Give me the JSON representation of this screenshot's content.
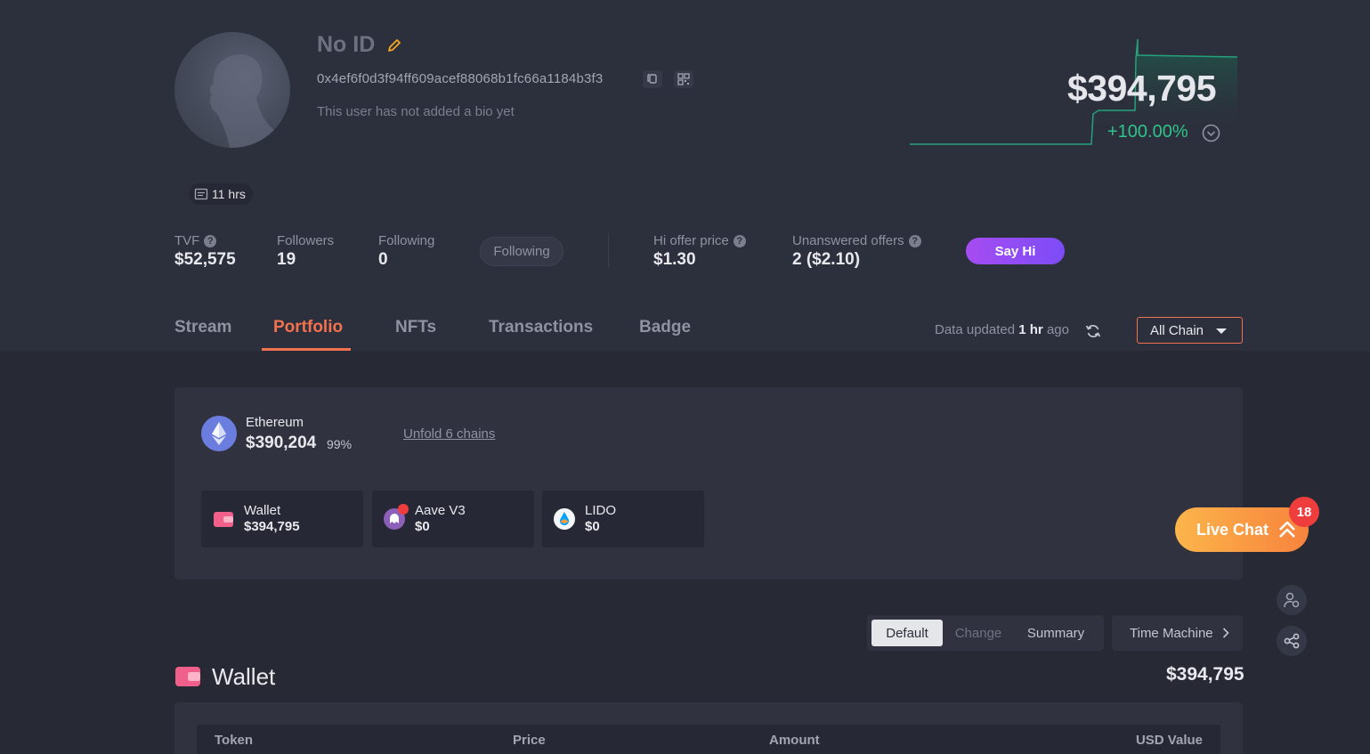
{
  "profile": {
    "name": "No ID",
    "address": "0x4ef6f0d3f94ff609acef88068b1fc66a1184b3f3",
    "bio": "This user has not added a bio yet",
    "age_badge": "11 hrs"
  },
  "net_worth": {
    "value": "$394,795",
    "change": "+100.00%"
  },
  "stats": {
    "tvf_label": "TVF",
    "tvf_value": "$52,575",
    "followers_label": "Followers",
    "followers_value": "19",
    "following_label": "Following",
    "following_value": "0",
    "follow_button": "Following",
    "hi_offer_label": "Hi offer price",
    "hi_offer_value": "$1.30",
    "unanswered_label": "Unanswered offers",
    "unanswered_value": "2 ($2.10)",
    "say_hi": "Say Hi"
  },
  "tabs": [
    {
      "label": "Stream"
    },
    {
      "label": "Portfolio",
      "active": true
    },
    {
      "label": "NFTs"
    },
    {
      "label": "Transactions"
    },
    {
      "label": "Badge"
    }
  ],
  "data_updated": {
    "prefix": "Data updated",
    "time": "1 hr",
    "suffix": "ago"
  },
  "chain_filter": "All Chain",
  "chain_summary": {
    "name": "Ethereum",
    "value": "$390,204",
    "percent": "99%",
    "unfold": "Unfold 6 chains"
  },
  "protocols": [
    {
      "name": "Wallet",
      "value": "$394,795",
      "icon": "wallet-icon"
    },
    {
      "name": "Aave V3",
      "value": "$0",
      "icon": "aave-icon"
    },
    {
      "name": "LIDO",
      "value": "$0",
      "icon": "lido-icon"
    }
  ],
  "live_chat": {
    "label": "Live Chat",
    "count": "18"
  },
  "view_modes": {
    "default": "Default",
    "change": "Change",
    "summary": "Summary",
    "time_machine": "Time Machine"
  },
  "wallet_section": {
    "title": "Wallet",
    "total": "$394,795",
    "columns": [
      "Token",
      "Price",
      "Amount",
      "USD Value"
    ]
  },
  "colors": {
    "accent": "#f2724f",
    "positive": "#2ec48a",
    "say_hi": "#a64cf2",
    "live_chat": "#f7833d",
    "badge": "#ef3d3d"
  }
}
